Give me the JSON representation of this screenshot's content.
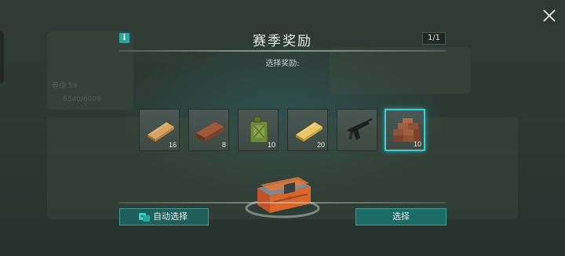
{
  "modal": {
    "title": "赛季奖励",
    "page_counter": "1/1",
    "subtitle": "选择奖励:",
    "info_icon_glyph": "i"
  },
  "rewards": [
    {
      "name": "wood-plank-icon",
      "quantity": "16",
      "selected": false
    },
    {
      "name": "brick-icon",
      "quantity": "8",
      "selected": false
    },
    {
      "name": "fuel-can-icon",
      "quantity": "10",
      "selected": false
    },
    {
      "name": "gold-plank-icon",
      "quantity": "20",
      "selected": false
    },
    {
      "name": "smg-icon",
      "quantity": "",
      "selected": false
    },
    {
      "name": "brick-stack-icon",
      "quantity": "10",
      "selected": true
    }
  ],
  "buttons": {
    "auto_select": "自动选择",
    "select": "选择"
  },
  "background": {
    "hint_text_1": "等级 59",
    "hint_text_2": "8340/6009"
  },
  "colors": {
    "accent_teal": "#39d0d0",
    "button_bg": "#1f5f5b",
    "chest_orange": "#d8672c"
  }
}
